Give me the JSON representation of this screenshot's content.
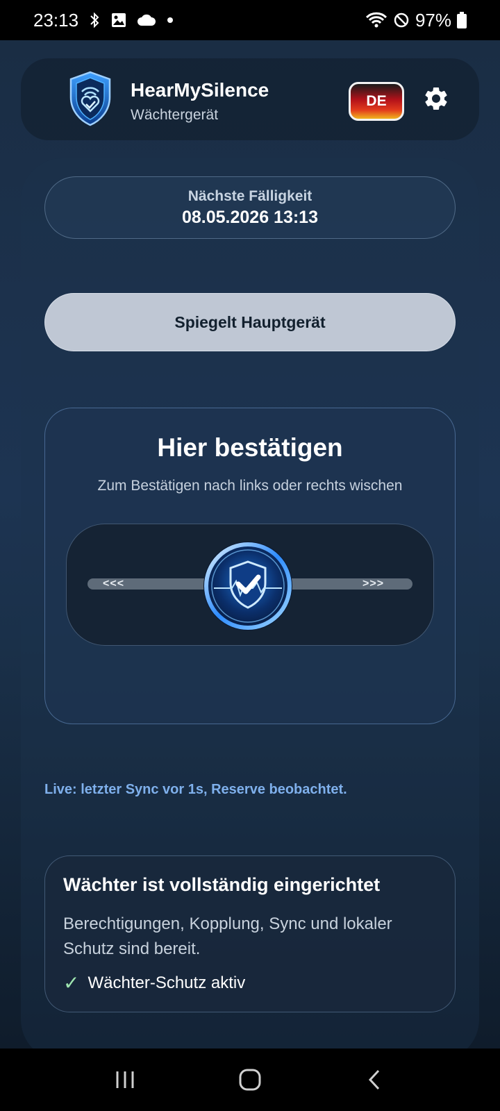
{
  "status_bar": {
    "time": "23:13",
    "battery": "97%",
    "icons": [
      "bluetooth-icon",
      "image-icon",
      "cloud-icon",
      "dot-icon",
      "wifi-icon",
      "do-not-disturb-icon",
      "battery-icon"
    ]
  },
  "header": {
    "title": "HearMySilence",
    "subtitle": "Wächtergerät",
    "language_label": "DE",
    "logo_icon": "shield-heart-logo",
    "settings_icon": "gear-icon"
  },
  "due": {
    "label": "Nächste Fälligkeit",
    "value": "08.05.2026 13:13"
  },
  "mirror_button": {
    "label": "Spiegelt Hauptgerät"
  },
  "confirm": {
    "title": "Hier bestätigen",
    "hint": "Zum Bestätigen nach links oder rechts wischen",
    "arrow_left": "<<<",
    "arrow_right": ">>>",
    "knob_icon": "shield-check-icon"
  },
  "live_status": "Live: letzter Sync vor 1s, Reserve beobachtet.",
  "setup": {
    "title": "Wächter ist vollständig eingerichtet",
    "description": "Berechtigungen, Kopplung, Sync und lokaler Schutz sind bereit.",
    "status_check": "✓",
    "status_label": "Wächter-Schutz aktiv"
  },
  "colors": {
    "accent_blue": "#7fb0ec",
    "check_green": "#9fe6b0",
    "button_gray": "#bfc7d4"
  },
  "nav": {
    "icons": [
      "recents-icon",
      "home-icon",
      "back-icon"
    ]
  }
}
